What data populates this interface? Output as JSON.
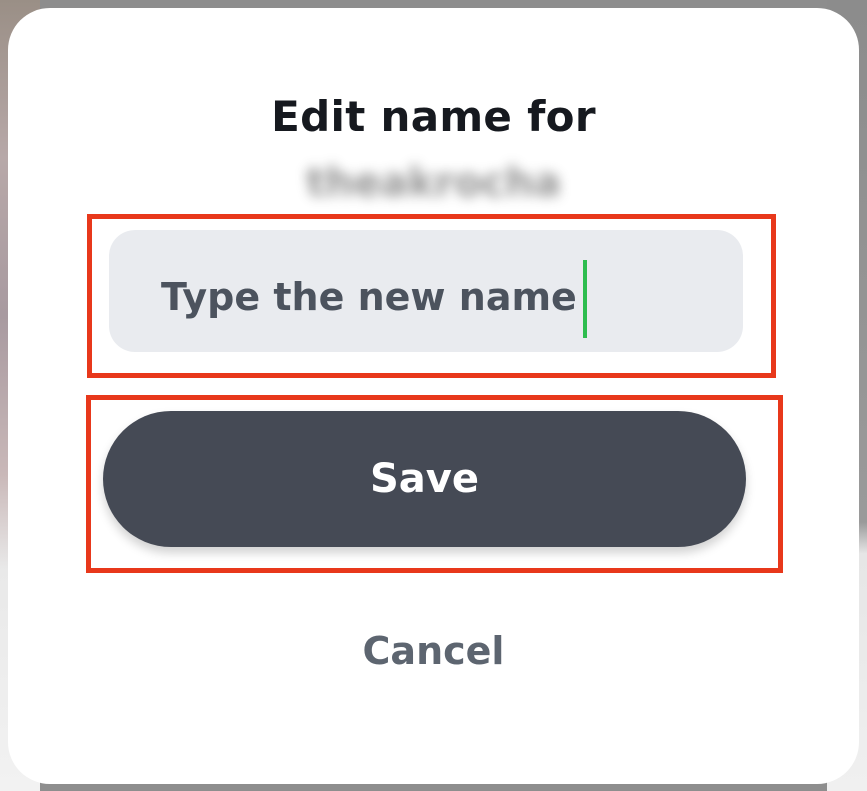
{
  "dialog": {
    "title": "Edit name for",
    "username": "theakrocha",
    "input": {
      "placeholder": "Type the new name",
      "value": "",
      "displayed_text": "Type the new name"
    },
    "save_label": "Save",
    "cancel_label": "Cancel"
  },
  "colors": {
    "highlight_outline": "#e8381b",
    "save_button_bg": "#454a55",
    "input_bg": "#e9ebef",
    "caret": "#2ebd4f",
    "cancel_text": "#5d6570"
  }
}
